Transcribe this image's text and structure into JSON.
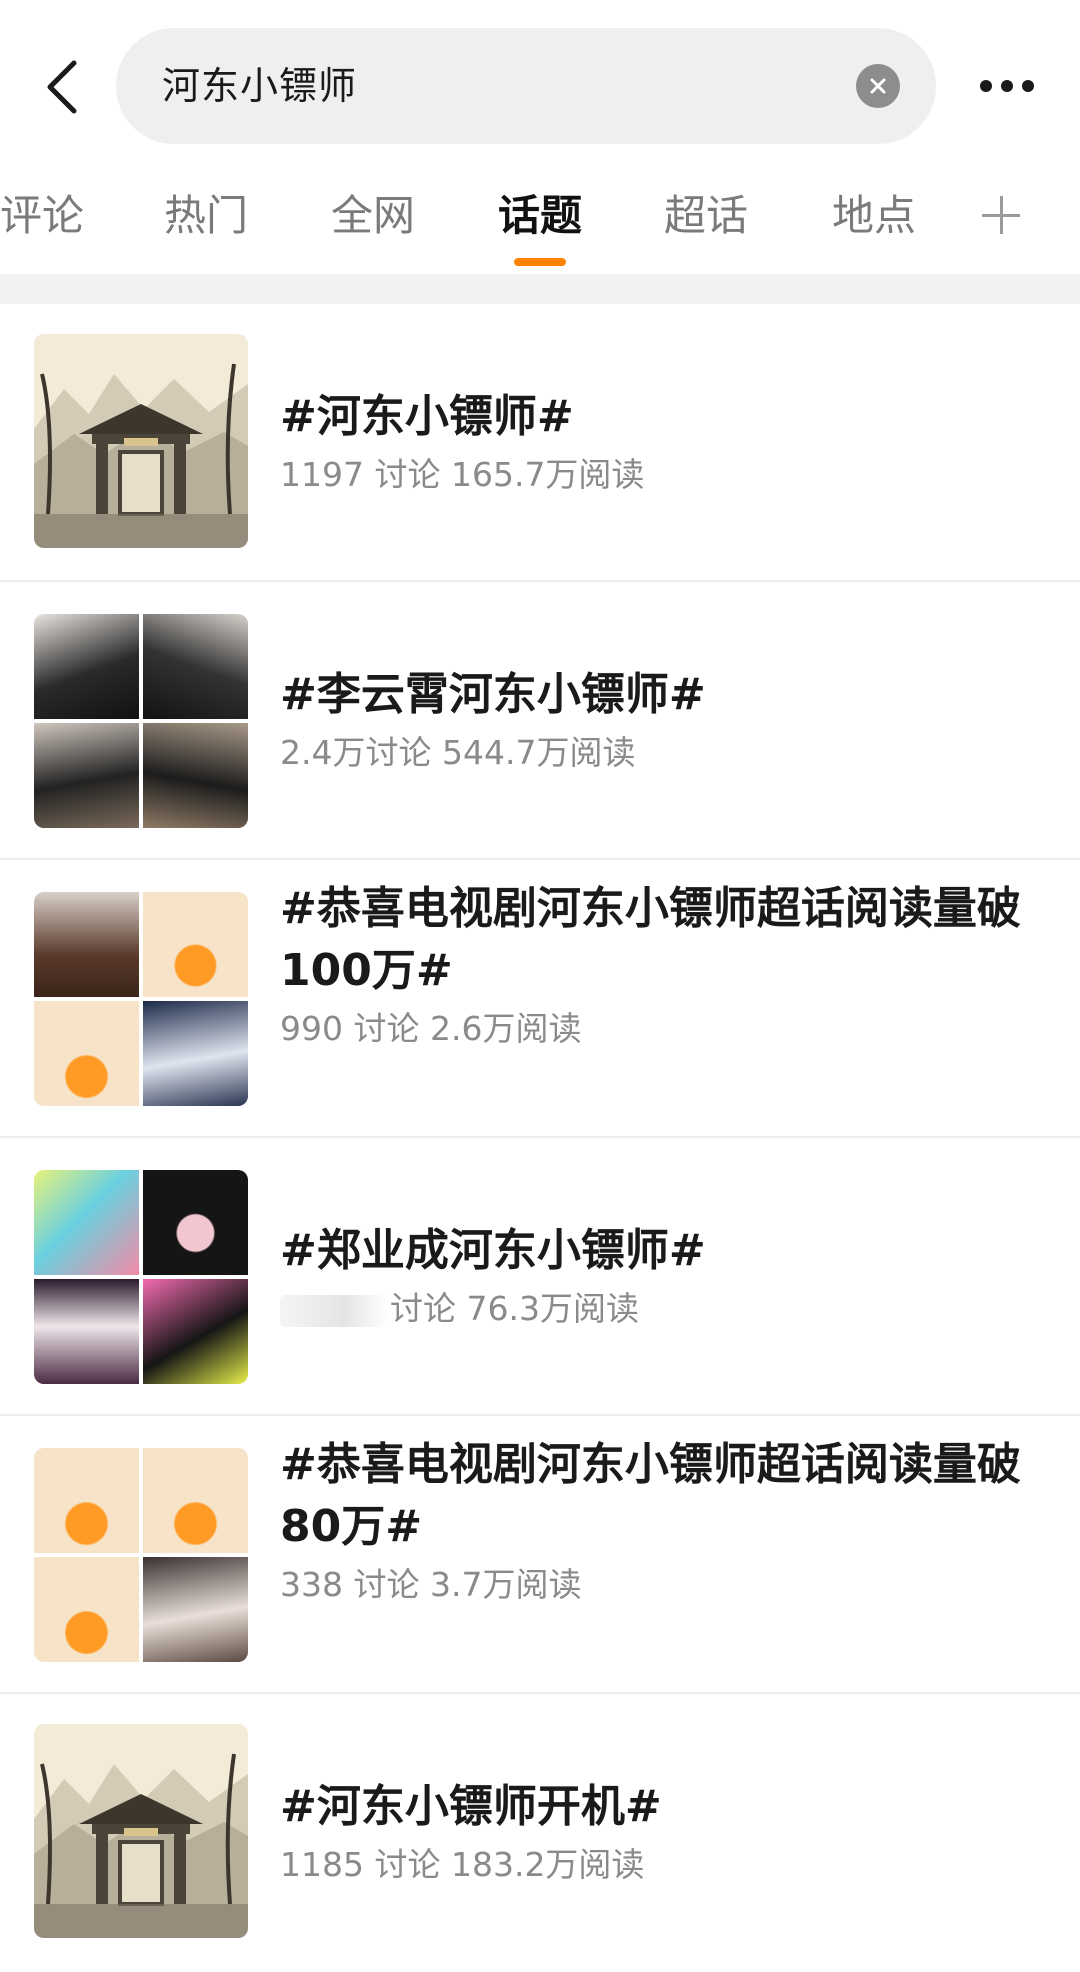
{
  "search": {
    "query": "河东小镖师"
  },
  "tabs": [
    {
      "label": "评论"
    },
    {
      "label": "热门"
    },
    {
      "label": "全网"
    },
    {
      "label": "话题",
      "active": true
    },
    {
      "label": "超话"
    },
    {
      "label": "地点"
    }
  ],
  "accent_color": "#ff8200",
  "results": [
    {
      "title": "#河东小镖师#",
      "meta": "1197 讨论 165.7万阅读",
      "thumb": "ink-painting-gate"
    },
    {
      "title": "#李云霄河东小镖师#",
      "meta": "2.4万讨论 544.7万阅读",
      "thumb": "photo-grid-black-tshirts"
    },
    {
      "title": "#恭喜电视剧河东小镖师超话阅读量破100万#",
      "meta": "990 讨论 2.6万阅读",
      "thumb": "photo-grid-badges-portraits"
    },
    {
      "title": "#郑业成河东小镖师#",
      "meta": "讨论 76.3万阅读",
      "thumb": "photo-grid-fan-art"
    },
    {
      "title": "#恭喜电视剧河东小镖师超话阅读量破80万#",
      "meta": "338 讨论 3.7万阅读",
      "thumb": "photo-grid-badges-portrait"
    },
    {
      "title": "#河东小镖师开机#",
      "meta": "1185 讨论 183.2万阅读",
      "thumb": "ink-painting-gate"
    }
  ]
}
